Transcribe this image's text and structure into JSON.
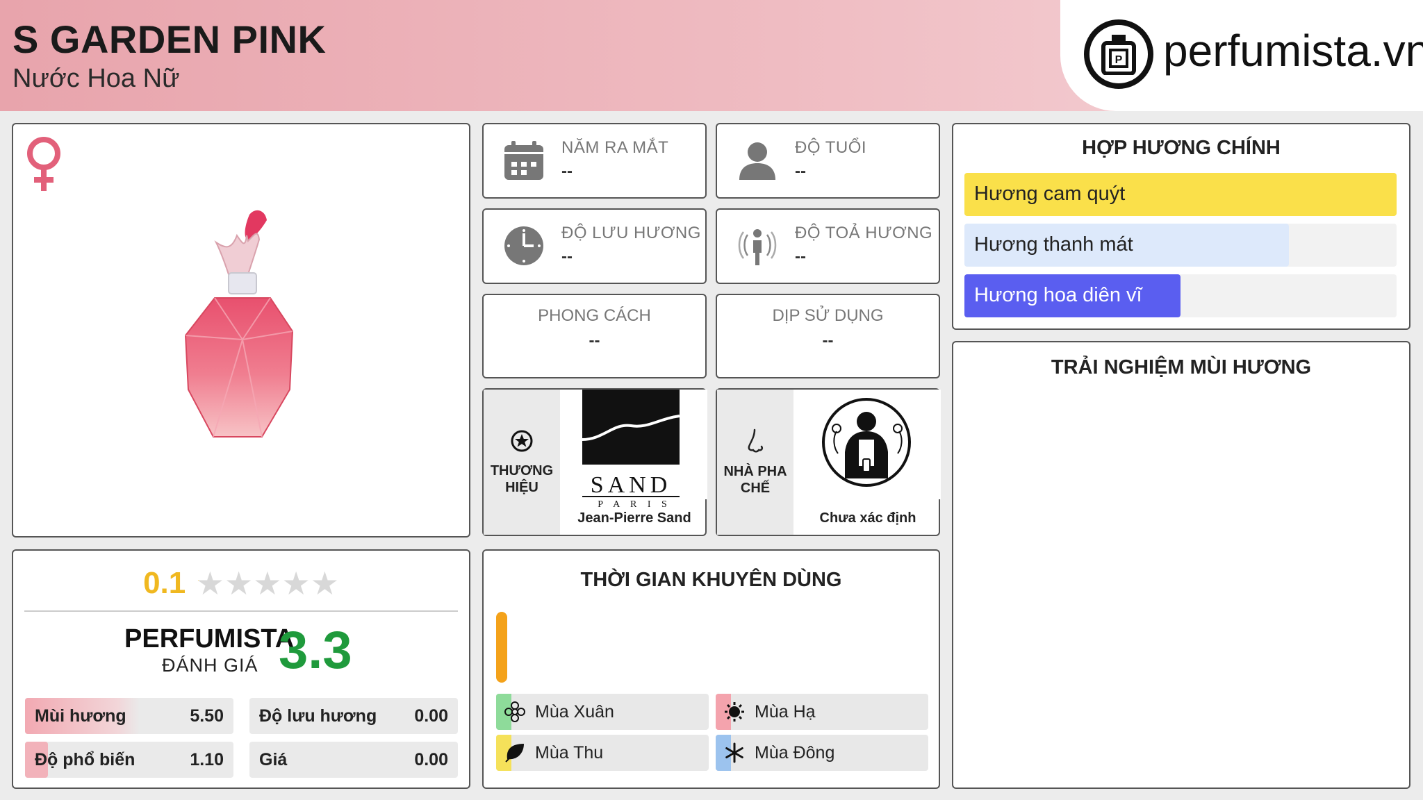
{
  "header": {
    "title": "S GARDEN PINK",
    "subtitle": "Nước Hoa Nữ",
    "logo_text": "perfumista.vn"
  },
  "rating": {
    "avg": "0.1",
    "stars_filled": 0.02,
    "perfumista_label": "PERFUMISTA",
    "perfumista_sub": "ĐÁNH GIÁ",
    "perfumista_score": "3.3",
    "metrics": [
      {
        "label": "Mùi hương",
        "value": "5.50",
        "fill": 0.55
      },
      {
        "label": "Độ lưu hương",
        "value": "0.00",
        "fill": 0
      },
      {
        "label": "Độ phổ biến",
        "value": "1.10",
        "fill": 0.11
      },
      {
        "label": "Giá",
        "value": "0.00",
        "fill": 0
      }
    ]
  },
  "info": {
    "year": {
      "label": "NĂM RA MẮT",
      "value": "--"
    },
    "age": {
      "label": "ĐỘ TUỔI",
      "value": "--"
    },
    "longevity": {
      "label": "ĐỘ LƯU HƯƠNG",
      "value": "--"
    },
    "sillage": {
      "label": "ĐỘ TOẢ HƯƠNG",
      "value": "--"
    },
    "style": {
      "label": "PHONG CÁCH",
      "value": "--"
    },
    "occasion": {
      "label": "DỊP SỬ DỤNG",
      "value": "--"
    },
    "brand": {
      "label_line1": "THƯƠNG",
      "label_line2": "HIỆU",
      "name": "Jean-Pierre Sand",
      "logo_word": "SAND",
      "logo_sub": "P A R I S"
    },
    "perfumer": {
      "label_line1": "NHÀ PHA",
      "label_line2": "CHẾ",
      "name": "Chưa xác định"
    }
  },
  "seasons": {
    "title": "THỜI GIAN KHUYÊN DÙNG",
    "items": [
      {
        "label": "Mùa Xuân",
        "color": "#8edb9a",
        "icon": "flower-icon"
      },
      {
        "label": "Mùa Hạ",
        "color": "#f4a3ad",
        "icon": "sun-icon"
      },
      {
        "label": "Mùa Thu",
        "color": "#f5e15a",
        "icon": "leaf-icon"
      },
      {
        "label": "Mùa Đông",
        "color": "#9cc3ee",
        "icon": "snowflake-icon"
      }
    ],
    "day_bar_color": "#f4a21a"
  },
  "accords": {
    "title": "HỢP HƯƠNG CHÍNH",
    "items": [
      {
        "label": "Hương cam quýt",
        "fill": 1.0,
        "color": "#fae04a",
        "text_color": "#222222"
      },
      {
        "label": "Hương thanh mát",
        "fill": 0.75,
        "color": "#dde9fb",
        "text_color": "#222222"
      },
      {
        "label": "Hương hoa diên vĩ",
        "fill": 0.5,
        "color": "#5a5ef0",
        "text_color": "#ffffff"
      }
    ]
  },
  "experience": {
    "title": "TRẢI NGHIỆM MÙI HƯƠNG"
  }
}
